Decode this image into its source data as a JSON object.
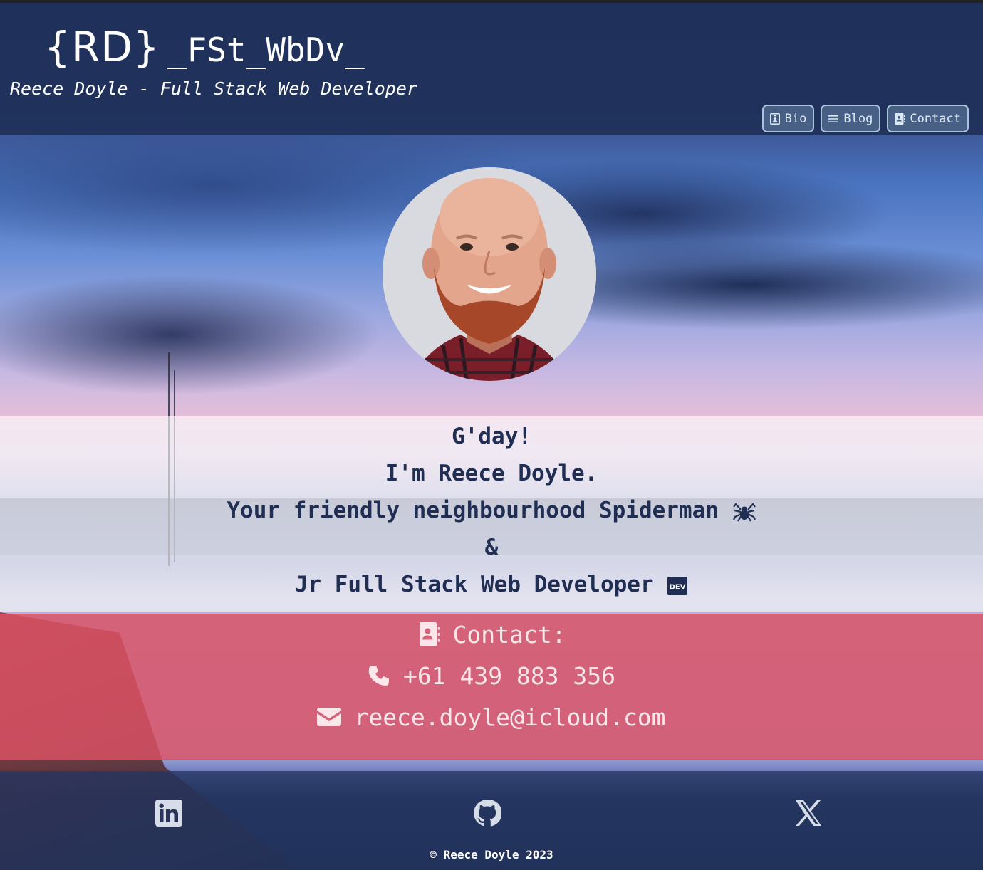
{
  "header": {
    "logo_rd": "{RD}",
    "logo_tag": "_FSt_WbDv_",
    "subtitle": "Reece Doyle - Full Stack Web Developer"
  },
  "nav": {
    "bio_label": "Bio",
    "blog_label": "Blog",
    "contact_label": "Contact"
  },
  "intro": {
    "line1": "G'day!",
    "line2": "I'm Reece Doyle.",
    "line3": "Your friendly neighbourhood Spiderman",
    "line4": "&",
    "line5": "Jr Full Stack Web Developer"
  },
  "contact": {
    "heading": "Contact:",
    "phone": "+61 439 883 356",
    "email": "reece.doyle@icloud.com"
  },
  "footer": {
    "copyright": "© Reece Doyle 2023"
  },
  "colors": {
    "header_bg": "#1e3058",
    "intro_text": "#1f2e52",
    "contact_bg": "#dc5064",
    "nav_border": "#a9c4dc"
  },
  "icons": {
    "nav_bio": "id-badge-icon",
    "nav_blog": "list-icon",
    "nav_contact": "address-book-icon",
    "spider": "spider-emoji",
    "dev": "dev-badge-icon",
    "phone": "phone-icon",
    "email": "envelope-icon",
    "linkedin": "linkedin-icon",
    "github": "github-icon",
    "x": "x-icon"
  }
}
